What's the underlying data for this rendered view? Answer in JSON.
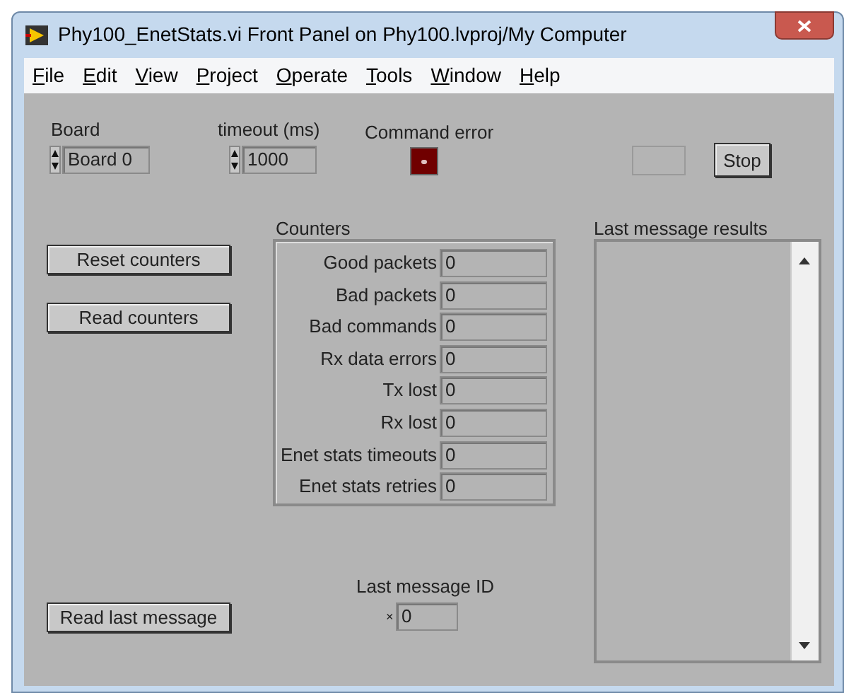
{
  "window": {
    "title": "Phy100_EnetStats.vi Front Panel on Phy100.lvproj/My Computer"
  },
  "menu": [
    {
      "label": "File"
    },
    {
      "label": "Edit"
    },
    {
      "label": "View"
    },
    {
      "label": "Project"
    },
    {
      "label": "Operate"
    },
    {
      "label": "Tools"
    },
    {
      "label": "Window"
    },
    {
      "label": "Help"
    }
  ],
  "board": {
    "label": "Board",
    "value": "Board 0"
  },
  "timeout": {
    "label": "timeout (ms)",
    "value": "1000"
  },
  "command_error": {
    "label": "Command error",
    "on": false
  },
  "stop_button": "Stop",
  "buttons": [
    "Reset counters",
    "Read counters",
    "Read last message"
  ],
  "counters": {
    "label": "Counters",
    "rows": [
      {
        "label": "Good packets",
        "value": "0"
      },
      {
        "label": "Bad packets",
        "value": "0"
      },
      {
        "label": "Bad commands",
        "value": "0"
      },
      {
        "label": "Rx data errors",
        "value": "0"
      },
      {
        "label": "Tx lost",
        "value": "0"
      },
      {
        "label": "Rx lost",
        "value": "0"
      },
      {
        "label": "Enet stats timeouts",
        "value": "0"
      },
      {
        "label": "Enet stats retries",
        "value": "0"
      }
    ]
  },
  "last_message_results": {
    "label": "Last message results"
  },
  "last_message_id": {
    "label": "Last message ID",
    "radix": "×",
    "value": "0"
  }
}
